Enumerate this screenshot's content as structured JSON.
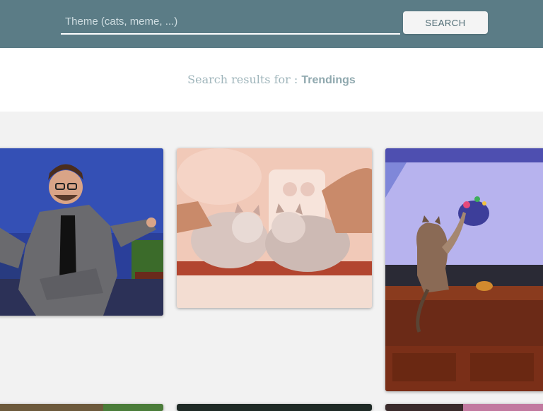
{
  "search": {
    "placeholder": "Theme (cats, meme, ...)",
    "value": "",
    "button_label": "SEARCH"
  },
  "results": {
    "prefix": "Search results for : ",
    "term": "Trendings"
  },
  "gifs": [
    {
      "subject": "man-in-suit-shrugging"
    },
    {
      "subject": "two-kittens-facing"
    },
    {
      "subject": "cat-pawing-tv"
    },
    {
      "subject": "partial-gif"
    },
    {
      "subject": "partial-gif"
    },
    {
      "subject": "partial-gif"
    }
  ],
  "colors": {
    "header_bg": "#5b7c86",
    "page_bg": "#f2f2f2",
    "results_text": "#9fb5bb"
  }
}
